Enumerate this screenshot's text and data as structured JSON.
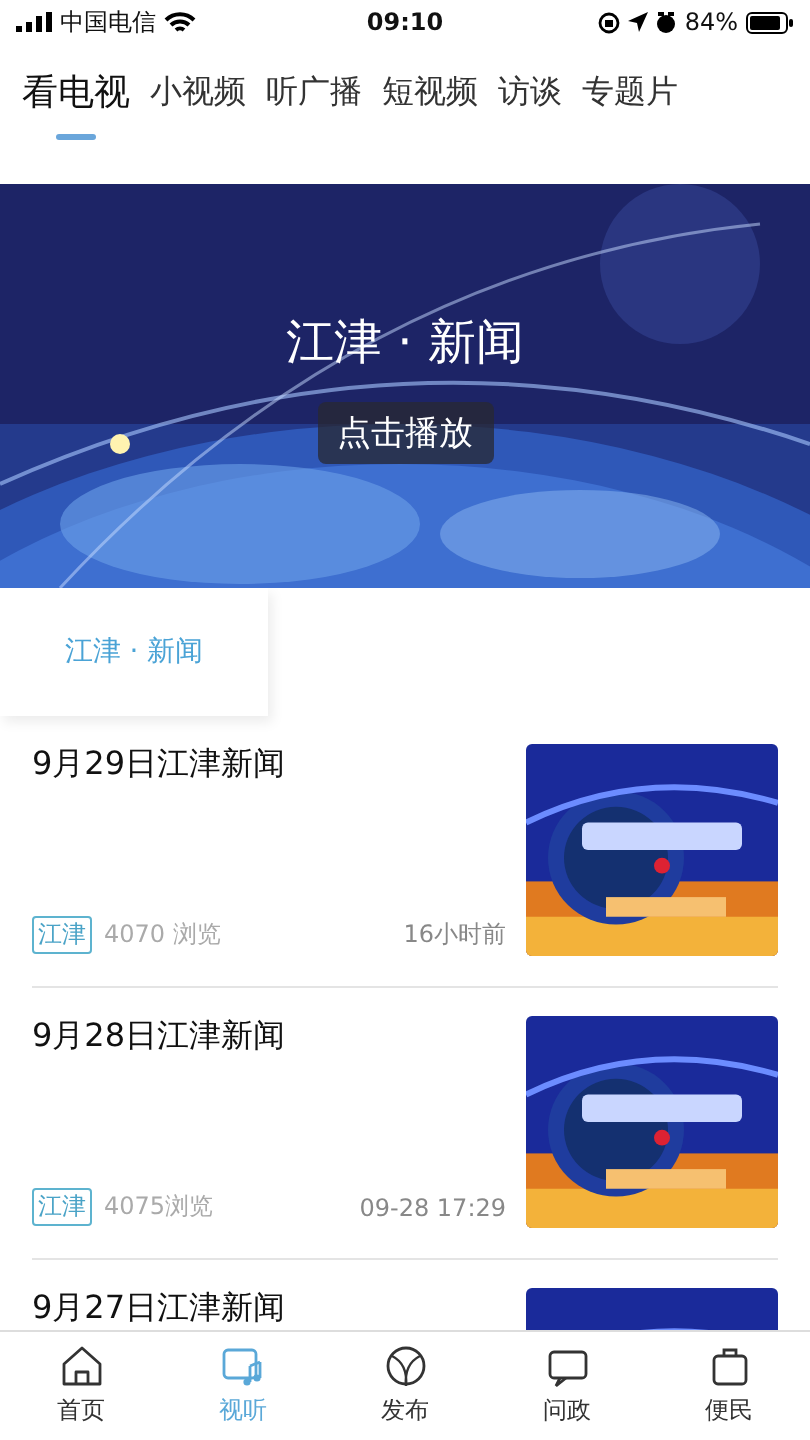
{
  "status_bar": {
    "carrier": "中国电信",
    "time": "09:10",
    "battery": "84%"
  },
  "tabs": [
    {
      "label": "看电视",
      "selected": true
    },
    {
      "label": "小视频",
      "selected": false
    },
    {
      "label": "听广播",
      "selected": false
    },
    {
      "label": "短视频",
      "selected": false
    },
    {
      "label": "访谈",
      "selected": false
    },
    {
      "label": "专题片",
      "selected": false
    }
  ],
  "banner": {
    "title": "江津 · 新闻",
    "play_button": "点击播放"
  },
  "channels": [
    {
      "label": "江津 · 新闻",
      "selected": true
    }
  ],
  "news": [
    {
      "title": "9月29日江津新闻",
      "tag": "江津",
      "views": "4070 浏览",
      "time": "16小时前"
    },
    {
      "title": "9月28日江津新闻",
      "tag": "江津",
      "views": "4075浏览",
      "time": "09-28 17:29"
    },
    {
      "title": "9月27日江津新闻"
    }
  ],
  "bottom_nav": [
    {
      "label": "首页",
      "selected": false
    },
    {
      "label": "视听",
      "selected": true
    },
    {
      "label": "发布",
      "selected": false
    },
    {
      "label": "问政",
      "selected": false
    },
    {
      "label": "便民",
      "selected": false
    }
  ]
}
